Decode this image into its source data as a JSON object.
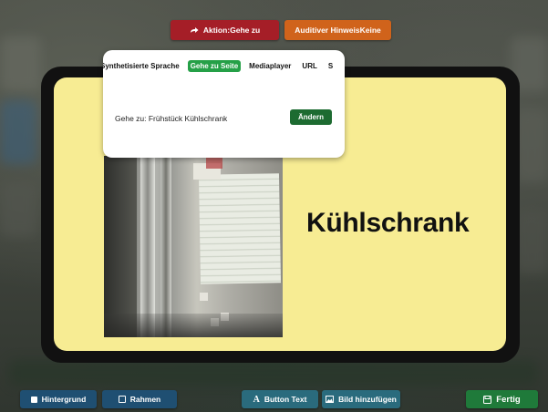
{
  "top_bar": {
    "action_button": {
      "label": "Aktion:Gehe zu",
      "icon": "share-arrow-icon",
      "color": "#a51e27"
    },
    "audio_hint_button": {
      "label": "Auditiver HinweisKeine",
      "color": "#d0631b"
    }
  },
  "popup": {
    "tabs": [
      {
        "label": "Synthetisierte Sprache",
        "active": false
      },
      {
        "label": "Gehe zu Seite",
        "active": true
      },
      {
        "label": "Mediaplayer",
        "active": false
      },
      {
        "label": "URL",
        "active": false
      },
      {
        "label": "S",
        "active": false
      }
    ],
    "goto_text": "Gehe zu: Frühstück Kühlschrank",
    "change_button": "Ändern",
    "active_color": "#25a047"
  },
  "card": {
    "title": "Kühlschrank",
    "background_color": "#f7ec93",
    "image": "refrigerator-photo"
  },
  "toolbar": {
    "background_button": {
      "label": "Hintergrund",
      "icon": "filled-square-icon"
    },
    "frame_button": {
      "label": "Rahmen",
      "icon": "outline-square-icon"
    },
    "button_text_button": {
      "label": "Button Text",
      "icon": "letter-a-icon",
      "glyph": "A"
    },
    "add_image_button": {
      "label": "Bild hinzufügen",
      "icon": "image-icon"
    },
    "done_button": {
      "label": "Fertig",
      "icon": "save-icon",
      "color": "#1f7a3a"
    }
  }
}
